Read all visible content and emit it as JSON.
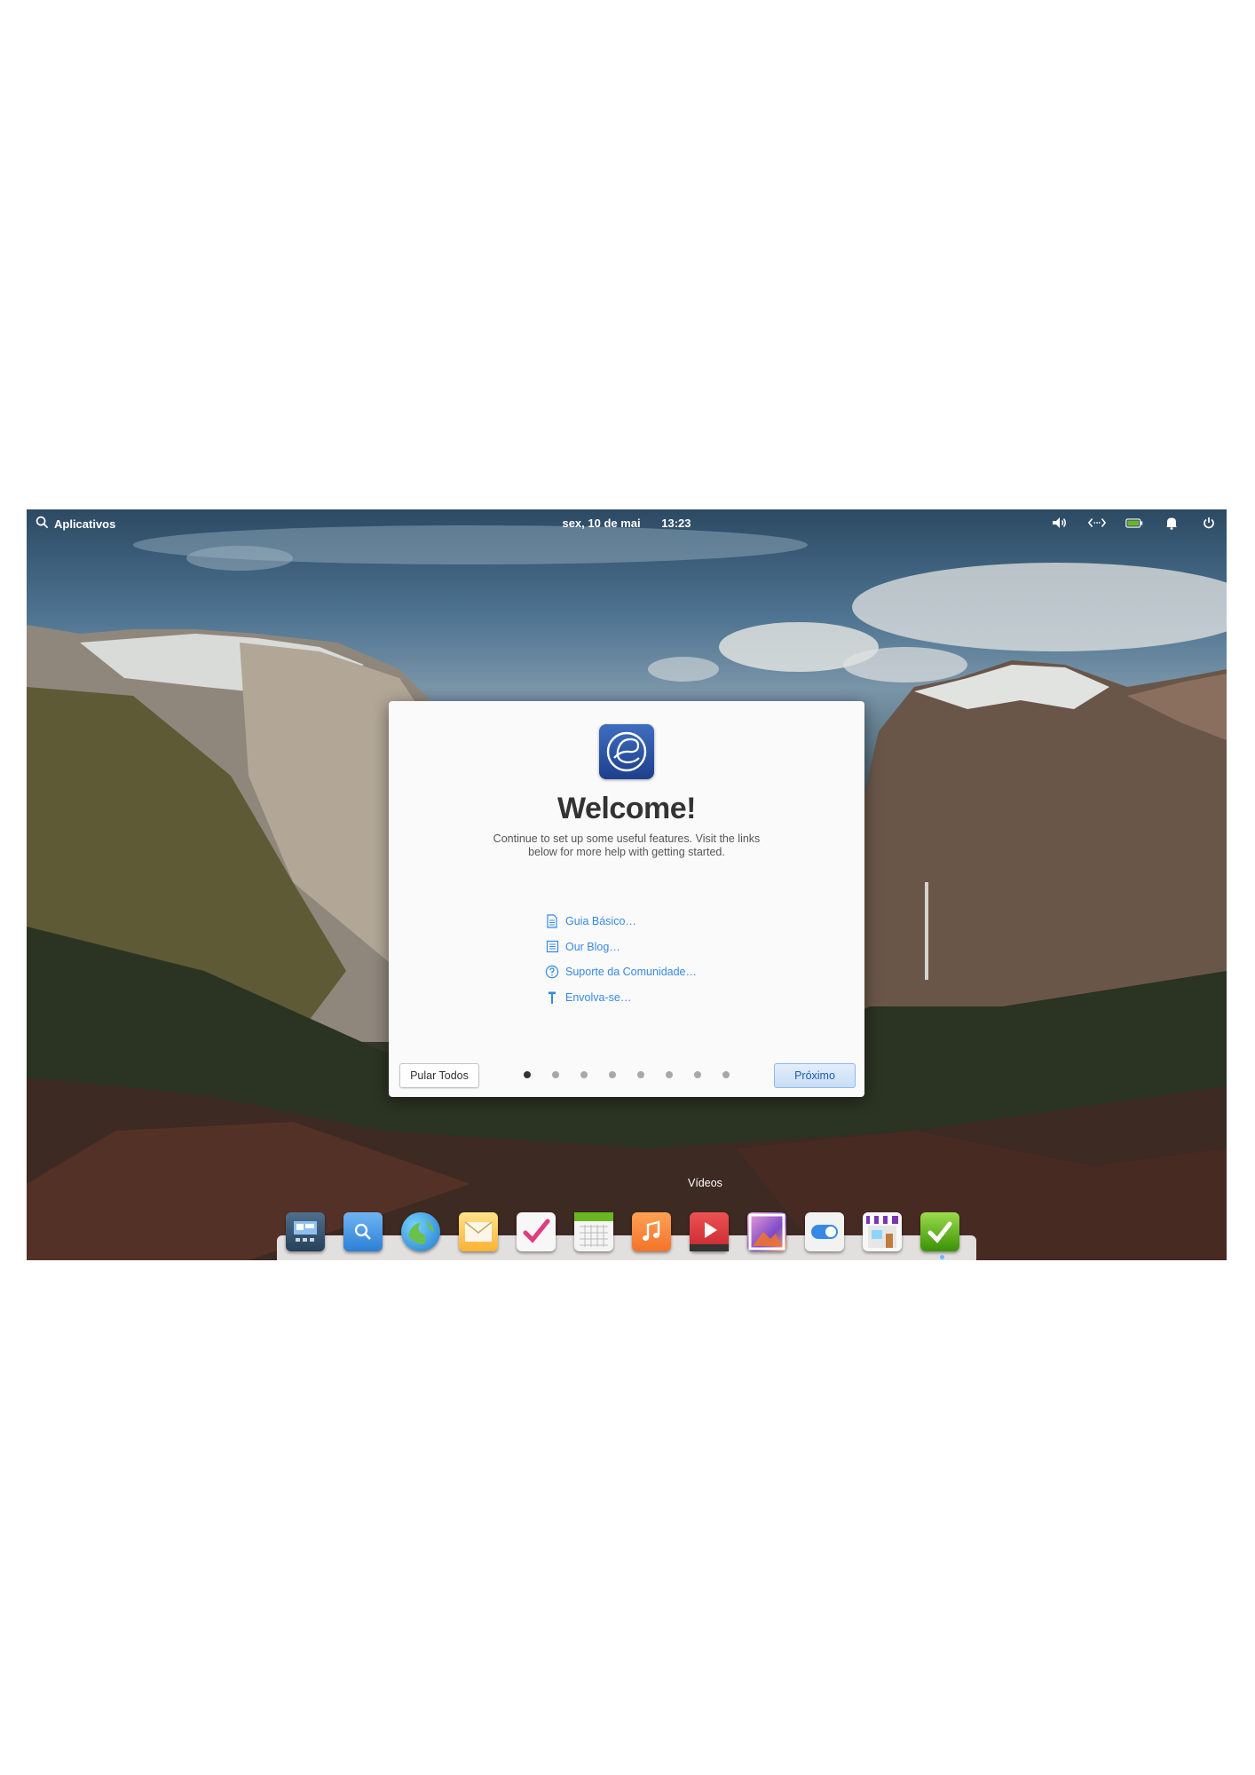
{
  "panel": {
    "applications_label": "Aplicativos",
    "date": "sex, 10 de mai",
    "time": "13:23",
    "indicators": [
      "volume-icon",
      "network-icon",
      "battery-icon",
      "notifications-icon",
      "power-icon"
    ]
  },
  "welcome_dialog": {
    "title": "Welcome!",
    "description": "Continue to set up some useful features. Visit the links below for more help with getting started.",
    "links": [
      {
        "label": "Guia Básico…",
        "icon": "document-icon"
      },
      {
        "label": "Our Blog…",
        "icon": "blog-icon"
      },
      {
        "label": "Suporte da Comunidade…",
        "icon": "help-icon"
      },
      {
        "label": "Envolva-se…",
        "icon": "tool-icon"
      }
    ],
    "skip_button": "Pular Todos",
    "next_button": "Próximo",
    "page_count": 8,
    "current_page": 1
  },
  "dock": {
    "tooltip": "Vídeos",
    "apps": [
      "multitasking-icon",
      "files-icon",
      "web-browser-icon",
      "mail-icon",
      "tasks-icon",
      "calendar-icon",
      "music-icon",
      "videos-icon",
      "photos-icon",
      "settings-icon",
      "appcenter-icon",
      "checklist-icon"
    ]
  },
  "colors": {
    "accent": "#3689e6",
    "dialog_bg": "#fafafa",
    "panel_text": "#ffffff"
  }
}
